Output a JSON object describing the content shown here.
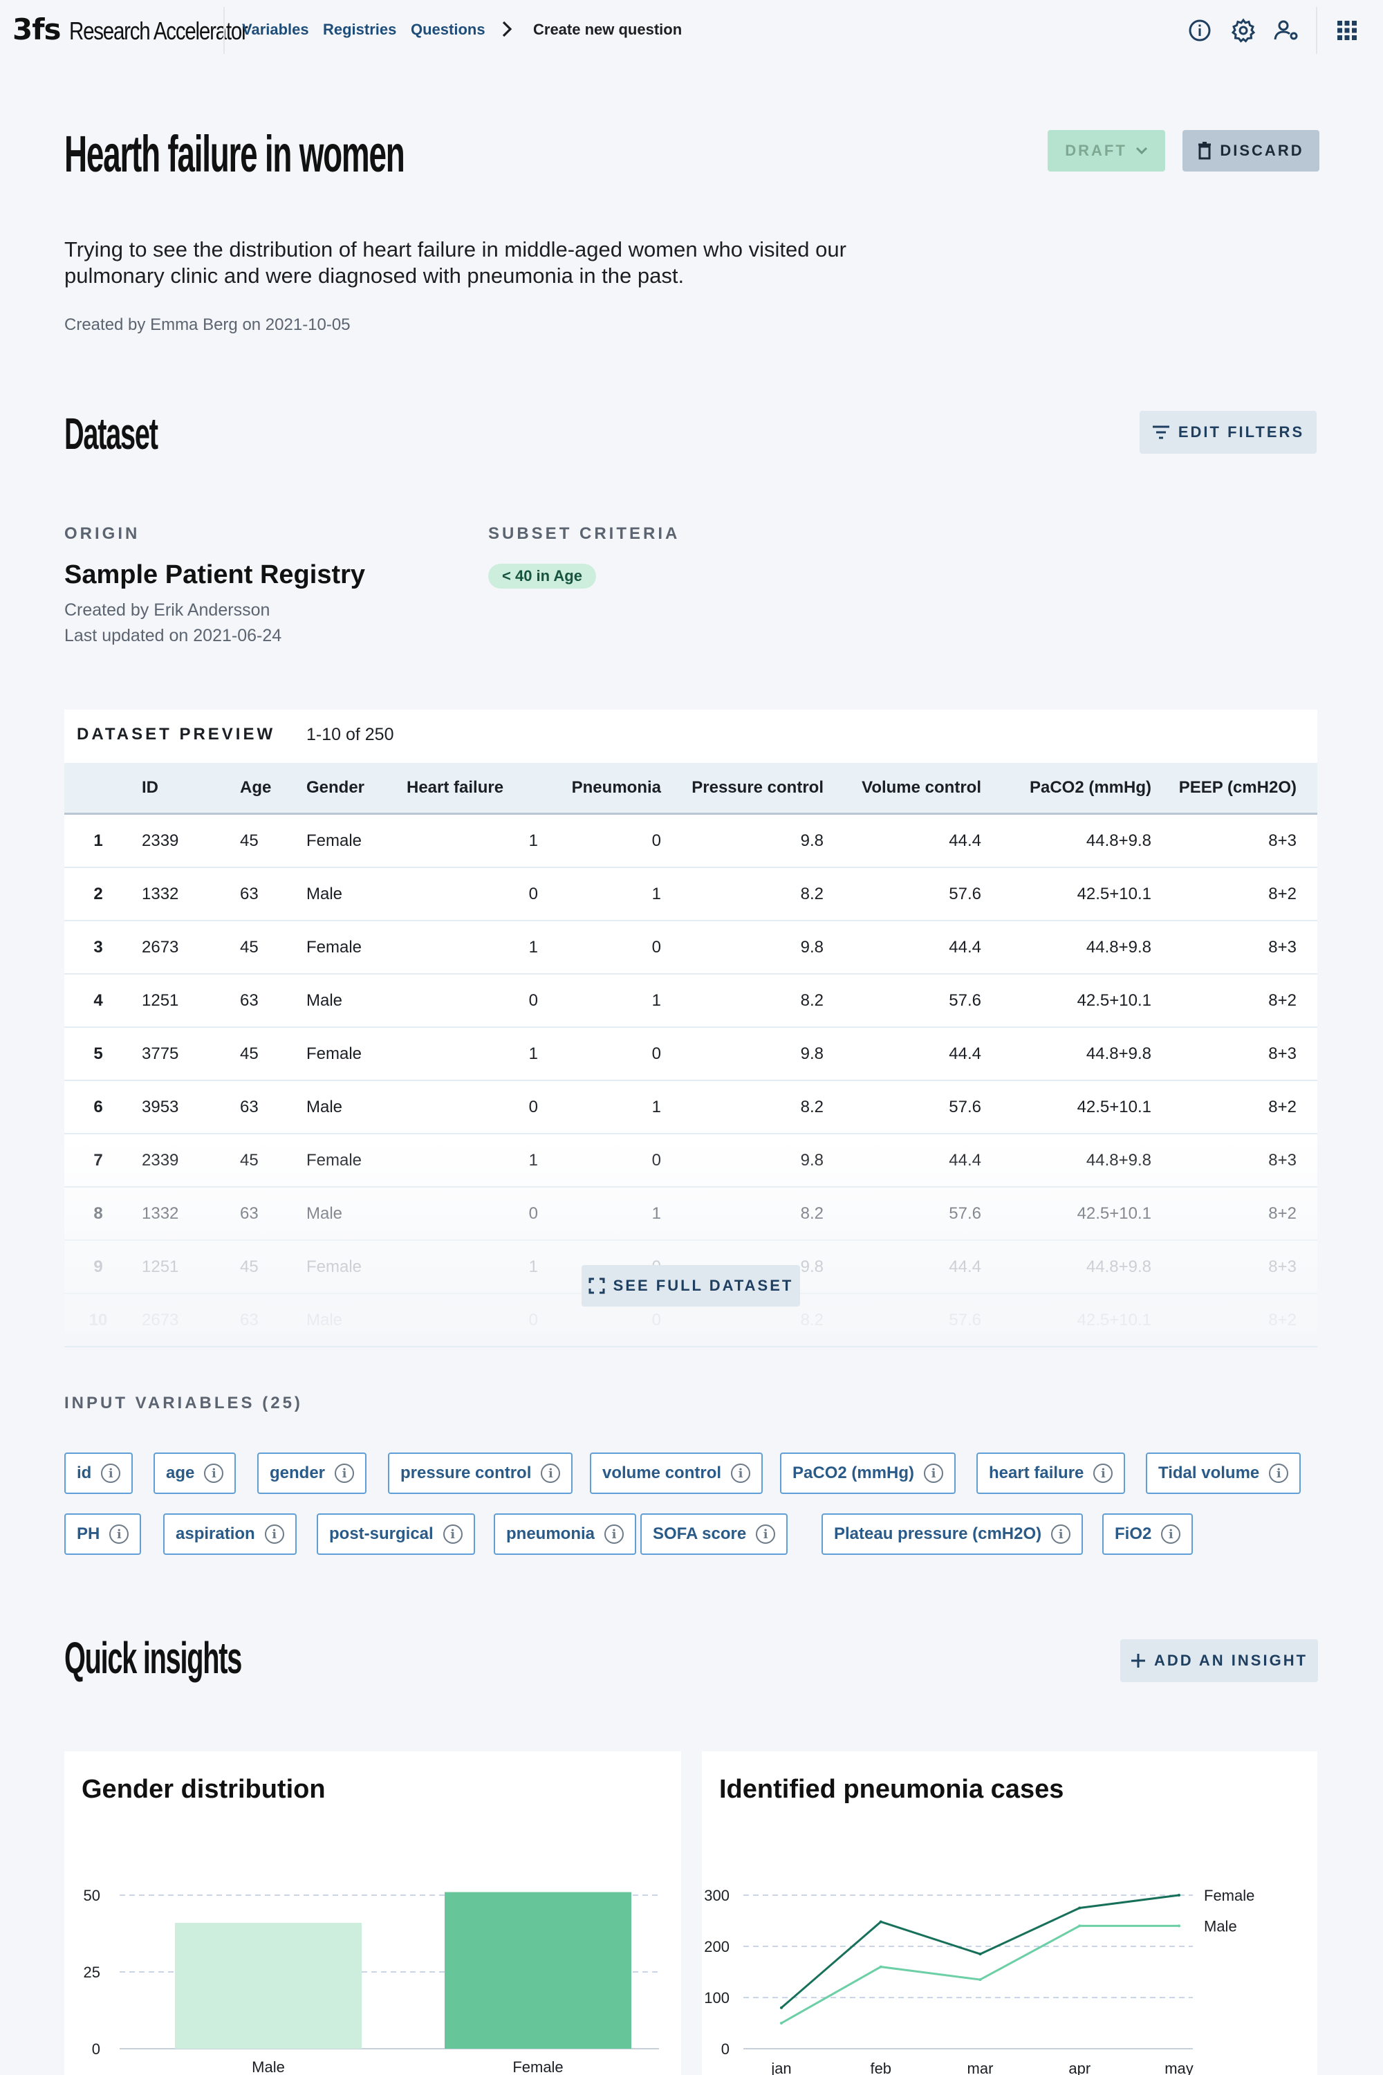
{
  "app": {
    "logo_mark": "3fs",
    "logo_text": "Research Accelerator"
  },
  "nav": {
    "variables": "Variables",
    "registries": "Registries",
    "questions": "Questions",
    "current": "Create new question"
  },
  "header_icons": [
    "info-icon",
    "gear-icon",
    "user-settings-icon",
    "apps-grid-icon"
  ],
  "question": {
    "title": "Hearth failure in women",
    "status_label": "DRAFT",
    "discard_label": "DISCARD",
    "description_line1": "Trying to see the distribution of heart failure in middle-aged women who visited our",
    "description_line2": "pulmonary clinic and were diagnosed with pneumonia in the past.",
    "created_by": "Created by Emma Berg on 2021-10-05"
  },
  "dataset": {
    "heading": "Dataset",
    "edit_filters_label": "EDIT FILTERS",
    "origin_label": "ORIGIN",
    "origin_name": "Sample Patient Registry",
    "origin_created_by": "Created by Erik Andersson",
    "origin_updated": "Last updated on 2021-06-24",
    "subset_label": "SUBSET CRITERIA",
    "subset_badge": "< 40 in Age"
  },
  "preview": {
    "label": "DATASET PREVIEW",
    "range": "1-10 of 250",
    "see_full_label": "SEE FULL DATASET",
    "columns": [
      "",
      "ID",
      "Age",
      "Gender",
      "Heart failure",
      "Pneumonia",
      "Pressure control",
      "Volume control",
      "PaCO2 (mmHg)",
      "PEEP (cmH2O)"
    ],
    "rows": [
      [
        "1",
        "2339",
        "45",
        "Female",
        "1",
        "0",
        "9.8",
        "44.4",
        "44.8+9.8",
        "8+3"
      ],
      [
        "2",
        "1332",
        "63",
        "Male",
        "0",
        "1",
        "8.2",
        "57.6",
        "42.5+10.1",
        "8+2"
      ],
      [
        "3",
        "2673",
        "45",
        "Female",
        "1",
        "0",
        "9.8",
        "44.4",
        "44.8+9.8",
        "8+3"
      ],
      [
        "4",
        "1251",
        "63",
        "Male",
        "0",
        "1",
        "8.2",
        "57.6",
        "42.5+10.1",
        "8+2"
      ],
      [
        "5",
        "3775",
        "45",
        "Female",
        "1",
        "0",
        "9.8",
        "44.4",
        "44.8+9.8",
        "8+3"
      ],
      [
        "6",
        "3953",
        "63",
        "Male",
        "0",
        "1",
        "8.2",
        "57.6",
        "42.5+10.1",
        "8+2"
      ],
      [
        "7",
        "2339",
        "45",
        "Female",
        "1",
        "0",
        "9.8",
        "44.4",
        "44.8+9.8",
        "8+3"
      ],
      [
        "8",
        "1332",
        "63",
        "Male",
        "0",
        "1",
        "8.2",
        "57.6",
        "42.5+10.1",
        "8+2"
      ],
      [
        "9",
        "1251",
        "45",
        "Female",
        "1",
        "0",
        "9.8",
        "44.4",
        "44.8+9.8",
        "8+3"
      ],
      [
        "10",
        "2673",
        "63",
        "Male",
        "0",
        "0",
        "8.2",
        "57.6",
        "42.5+10.1",
        "8+2"
      ]
    ]
  },
  "input_variables": {
    "label": "INPUT VARIABLES (25)",
    "chips": [
      "id",
      "age",
      "gender",
      "pressure control",
      "volume control",
      "PaCO2 (mmHg)",
      "heart failure",
      "Tidal volume",
      "PH",
      "aspiration",
      "post-surgical",
      "pneumonia",
      "SOFA score",
      "Plateau pressure (cmH2O)",
      "FiO2"
    ]
  },
  "insights": {
    "heading": "Quick insights",
    "add_label": "ADD AN INSIGHT",
    "gender_title": "Gender distribution",
    "pneumonia_title": "Identified pneumonia cases"
  },
  "chart_data": [
    {
      "type": "bar",
      "title": "Gender distribution",
      "categories": [
        "Male",
        "Female"
      ],
      "values": [
        41,
        51
      ],
      "yticks": [
        "0",
        "25",
        "50"
      ],
      "ylim": [
        0,
        50
      ],
      "colors": [
        "#cdeedd",
        "#67c699"
      ],
      "grid": true
    },
    {
      "type": "line",
      "title": "Identified pneumonia cases",
      "x": [
        "jan",
        "feb",
        "mar",
        "apr",
        "may"
      ],
      "yticks": [
        "0",
        "100",
        "200",
        "300"
      ],
      "ylim": [
        0,
        300
      ],
      "series": [
        {
          "name": "Female",
          "values": [
            80,
            248,
            185,
            275,
            300
          ],
          "color": "#17715a"
        },
        {
          "name": "Male",
          "values": [
            50,
            160,
            135,
            240,
            240
          ],
          "color": "#6ccfa6"
        }
      ],
      "legend": "right",
      "grid": true
    }
  ]
}
